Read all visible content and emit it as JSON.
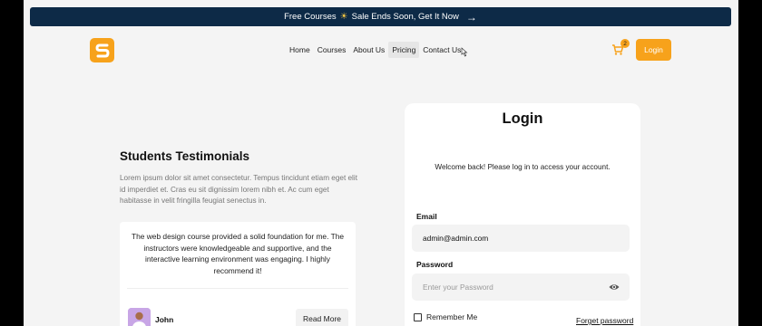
{
  "banner": {
    "text_before": "Free Courses",
    "sun_icon": "☀",
    "text_after": "Sale Ends Soon, Get It Now",
    "arrow": "→"
  },
  "brand": {
    "accent": "#f7a21b",
    "banner_bg": "#0d2a47",
    "logo_letter": "S"
  },
  "nav": {
    "items": [
      {
        "label": "Home"
      },
      {
        "label": "Courses"
      },
      {
        "label": "About Us"
      },
      {
        "label": "Pricing"
      },
      {
        "label": "Contact Us"
      }
    ]
  },
  "cart": {
    "count": "2"
  },
  "header": {
    "login_label": "Login"
  },
  "testimonials": {
    "title": "Students Testimonials",
    "intro": "Lorem ipsum dolor sit amet consectetur. Tempus tincidunt etiam eget elit id imperdiet et. Cras eu sit dignissim lorem nibh et. Ac cum eget habitasse in velit fringilla feugiat senectus in.",
    "card": {
      "quote": "The web design course provided a solid foundation for me. The instructors were knowledgeable and supportive, and the interactive learning environment was engaging. I highly recommend it!",
      "name": "John",
      "read_more": "Read More"
    }
  },
  "login": {
    "title": "Login",
    "welcome": "Welcome back! Please log in to access your account.",
    "email_label": "Email",
    "email_value": "admin@admin.com",
    "password_label": "Password",
    "password_placeholder": "Enter your Password",
    "remember_label": "Remember Me",
    "forget_label": "Forget password"
  }
}
